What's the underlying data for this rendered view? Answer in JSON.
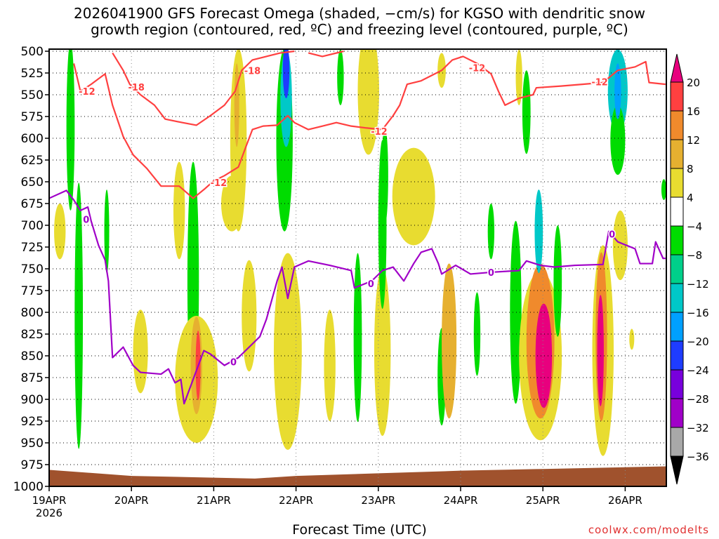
{
  "chart_data": {
    "type": "heatmap",
    "title_line1": "2026041900 GFS Forecast Omega (shaded, −cm/s) for KGSO with dendritic snow",
    "title_line2": "growth region (contoured, red, ºC) and freezing level (contoured, purple, ºC)",
    "xlabel": "Forecast Time (UTC)",
    "credit": "coolwx.com/modelts",
    "x_unit": "days since 19APR 00Z",
    "xlim": [
      0,
      7.5
    ],
    "ylim": [
      500,
      1000
    ],
    "y_ticks": [
      "500",
      "525",
      "550",
      "575",
      "600",
      "625",
      "650",
      "675",
      "700",
      "725",
      "750",
      "775",
      "800",
      "825",
      "850",
      "875",
      "900",
      "925",
      "950",
      "975",
      "1000"
    ],
    "x_ticks": [
      {
        "t": 0,
        "label": "19APR",
        "sub": "2026"
      },
      {
        "t": 1,
        "label": "20APR"
      },
      {
        "t": 2,
        "label": "21APR"
      },
      {
        "t": 3,
        "label": "22APR"
      },
      {
        "t": 4,
        "label": "23APR"
      },
      {
        "t": 5,
        "label": "24APR"
      },
      {
        "t": 6,
        "label": "25APR"
      },
      {
        "t": 7,
        "label": "26APR"
      }
    ],
    "grid": "dotted",
    "colorbar": {
      "labels": [
        "20",
        "16",
        "12",
        "8",
        "4",
        "−4",
        "−8",
        "−12",
        "−16",
        "−20",
        "−24",
        "−28",
        "−32",
        "−36"
      ],
      "over_color": "#e8007e",
      "under_color": "#000000",
      "colors": [
        "#ff4040",
        "#f08a2c",
        "#e6b030",
        "#e8dc30",
        "#ffffff",
        "#00dc00",
        "#00d08a",
        "#00c8c8",
        "#00a0ff",
        "#1e3cff",
        "#7800dc",
        "#a000c8",
        "#a8a8a8"
      ]
    },
    "omega_regions": [
      {
        "t": 0.26,
        "p": 586,
        "dt": 0.05,
        "dp": 97,
        "v": -6
      },
      {
        "t": 0.36,
        "p": 804,
        "dt": 0.05,
        "dp": 153,
        "v": -6
      },
      {
        "t": 0.13,
        "p": 707,
        "dt": 0.07,
        "dp": 32,
        "v": 6
      },
      {
        "t": 1.11,
        "p": 845,
        "dt": 0.09,
        "dp": 48,
        "v": 6
      },
      {
        "t": 0.7,
        "p": 707,
        "dt": 0.03,
        "dp": 48,
        "v": -6
      },
      {
        "t": 1.75,
        "p": 764,
        "dt": 0.07,
        "dp": 137,
        "v": -6
      },
      {
        "t": 1.79,
        "p": 877,
        "dt": 0.26,
        "dp": 73,
        "v": 6
      },
      {
        "t": 1.79,
        "p": 861,
        "dt": 0.07,
        "dp": 56,
        "v": 10
      },
      {
        "t": 1.81,
        "p": 861,
        "dt": 0.03,
        "dp": 40,
        "v": 18
      },
      {
        "t": 1.58,
        "p": 683,
        "dt": 0.07,
        "dp": 56,
        "v": 6
      },
      {
        "t": 2.3,
        "p": 602,
        "dt": 0.1,
        "dp": 105,
        "v": 6
      },
      {
        "t": 2.28,
        "p": 562,
        "dt": 0.03,
        "dp": 48,
        "v": 10
      },
      {
        "t": 2.22,
        "p": 675,
        "dt": 0.13,
        "dp": 32,
        "v": 6
      },
      {
        "t": 2.86,
        "p": 602,
        "dt": 0.1,
        "dp": 105,
        "v": -6
      },
      {
        "t": 2.88,
        "p": 554,
        "dt": 0.07,
        "dp": 56,
        "v": -14
      },
      {
        "t": 2.88,
        "p": 522,
        "dt": 0.04,
        "dp": 32,
        "v": -22
      },
      {
        "t": 2.9,
        "p": 845,
        "dt": 0.17,
        "dp": 113,
        "v": 6
      },
      {
        "t": 2.43,
        "p": 804,
        "dt": 0.09,
        "dp": 64,
        "v": 6
      },
      {
        "t": 3.88,
        "p": 546,
        "dt": 0.13,
        "dp": 73,
        "v": 6
      },
      {
        "t": 3.41,
        "p": 861,
        "dt": 0.07,
        "dp": 64,
        "v": 6
      },
      {
        "t": 3.75,
        "p": 829,
        "dt": 0.05,
        "dp": 97,
        "v": -6
      },
      {
        "t": 4.05,
        "p": 845,
        "dt": 0.1,
        "dp": 97,
        "v": 6
      },
      {
        "t": 4.05,
        "p": 699,
        "dt": 0.05,
        "dp": 97,
        "v": -6
      },
      {
        "t": 4.43,
        "p": 667,
        "dt": 0.26,
        "dp": 56,
        "v": 6
      },
      {
        "t": 4.77,
        "p": 874,
        "dt": 0.05,
        "dp": 56,
        "v": -6
      },
      {
        "t": 4.86,
        "p": 833,
        "dt": 0.09,
        "dp": 89,
        "v": 10
      },
      {
        "t": 5.2,
        "p": 825,
        "dt": 0.04,
        "dp": 48,
        "v": -6
      },
      {
        "t": 5.67,
        "p": 800,
        "dt": 0.07,
        "dp": 105,
        "v": -6
      },
      {
        "t": 5.97,
        "p": 850,
        "dt": 0.26,
        "dp": 97,
        "v": 6
      },
      {
        "t": 5.97,
        "p": 833,
        "dt": 0.17,
        "dp": 89,
        "v": 14
      },
      {
        "t": 6.01,
        "p": 850,
        "dt": 0.1,
        "dp": 60,
        "v": 24
      },
      {
        "t": 5.95,
        "p": 707,
        "dt": 0.05,
        "dp": 48,
        "v": -14
      },
      {
        "t": 6.18,
        "p": 764,
        "dt": 0.05,
        "dp": 64,
        "v": -6
      },
      {
        "t": 5.8,
        "p": 570,
        "dt": 0.05,
        "dp": 48,
        "v": -6
      },
      {
        "t": 6.73,
        "p": 844,
        "dt": 0.13,
        "dp": 121,
        "v": 6
      },
      {
        "t": 6.71,
        "p": 828,
        "dt": 0.07,
        "dp": 97,
        "v": 14
      },
      {
        "t": 6.7,
        "p": 844,
        "dt": 0.04,
        "dp": 64,
        "v": 24
      },
      {
        "t": 6.91,
        "p": 546,
        "dt": 0.12,
        "dp": 48,
        "v": -14
      },
      {
        "t": 6.91,
        "p": 602,
        "dt": 0.09,
        "dp": 40,
        "v": -6
      },
      {
        "t": 6.91,
        "p": 546,
        "dt": 0.04,
        "dp": 32,
        "v": -18
      },
      {
        "t": 6.94,
        "p": 723,
        "dt": 0.09,
        "dp": 40,
        "v": 6
      },
      {
        "t": 7.47,
        "p": 659,
        "dt": 0.03,
        "dp": 12,
        "v": -6
      },
      {
        "t": 7.08,
        "p": 831,
        "dt": 0.03,
        "dp": 12,
        "v": 6
      },
      {
        "t": 5.37,
        "p": 707,
        "dt": 0.04,
        "dp": 32,
        "v": -6
      },
      {
        "t": 5.71,
        "p": 530,
        "dt": 0.04,
        "dp": 32,
        "v": 6
      },
      {
        "t": 4.77,
        "p": 522,
        "dt": 0.05,
        "dp": 20,
        "v": 6
      },
      {
        "t": 3.54,
        "p": 530,
        "dt": 0.04,
        "dp": 32,
        "v": -6
      },
      {
        "t": 4.08,
        "p": 643,
        "dt": 0.04,
        "dp": 56,
        "v": -6
      }
    ],
    "surface_pressure": [
      [
        0,
        981
      ],
      [
        1,
        988
      ],
      [
        2,
        990
      ],
      [
        2.5,
        991
      ],
      [
        3,
        988
      ],
      [
        4,
        985
      ],
      [
        5,
        982
      ],
      [
        6,
        980
      ],
      [
        7.5,
        977
      ]
    ],
    "dgz_contours": [
      {
        "level": -12,
        "color": "#ff4040",
        "points": [
          [
            0.3,
            514
          ],
          [
            0.38,
            546
          ],
          [
            0.51,
            538
          ],
          [
            0.68,
            526
          ],
          [
            0.77,
            562
          ],
          [
            0.9,
            598
          ],
          [
            1.02,
            619
          ],
          [
            1.19,
            635
          ],
          [
            1.36,
            655
          ],
          [
            1.58,
            655
          ],
          [
            1.75,
            669
          ],
          [
            1.88,
            659
          ],
          [
            2.0,
            649
          ],
          [
            2.13,
            643
          ],
          [
            2.3,
            633
          ],
          [
            2.39,
            610
          ],
          [
            2.47,
            590
          ],
          [
            2.6,
            586
          ],
          [
            2.77,
            585
          ],
          [
            2.9,
            574
          ],
          [
            2.98,
            582
          ],
          [
            3.15,
            590
          ],
          [
            3.32,
            586
          ],
          [
            3.49,
            582
          ],
          [
            3.67,
            586
          ],
          [
            3.84,
            588
          ],
          [
            4.05,
            590
          ],
          [
            4.18,
            574
          ],
          [
            4.26,
            562
          ],
          [
            4.35,
            538
          ],
          [
            4.52,
            534
          ],
          [
            4.77,
            522
          ],
          [
            4.9,
            510
          ],
          [
            5.03,
            506
          ],
          [
            5.2,
            514
          ],
          [
            5.37,
            526
          ],
          [
            5.46,
            546
          ],
          [
            5.54,
            562
          ],
          [
            5.71,
            554
          ],
          [
            5.88,
            550
          ],
          [
            5.92,
            542
          ],
          [
            6.22,
            540
          ],
          [
            6.48,
            538
          ],
          [
            6.73,
            536
          ],
          [
            6.91,
            522
          ],
          [
            7.12,
            518
          ],
          [
            7.25,
            512
          ],
          [
            7.29,
            536
          ],
          [
            7.49,
            538
          ]
        ]
      },
      {
        "level": -18,
        "color": "#ff4040",
        "points": [
          [
            0.77,
            502
          ],
          [
            0.9,
            522
          ],
          [
            0.98,
            538
          ],
          [
            1.11,
            550
          ],
          [
            1.28,
            562
          ],
          [
            1.41,
            578
          ],
          [
            1.62,
            582
          ],
          [
            1.79,
            585
          ],
          [
            1.96,
            574
          ],
          [
            2.13,
            562
          ],
          [
            2.26,
            546
          ],
          [
            2.34,
            522
          ],
          [
            2.47,
            510
          ],
          [
            2.64,
            506
          ],
          [
            2.81,
            502
          ],
          [
            2.98,
            500
          ]
        ]
      },
      {
        "level": -18,
        "color": "#ff4040",
        "points": [
          [
            3.15,
            502
          ],
          [
            3.32,
            506
          ],
          [
            3.58,
            500
          ]
        ]
      }
    ],
    "freezing_level": {
      "level": 0,
      "color": "#a000c8",
      "points": [
        [
          0,
          669
        ],
        [
          0.21,
          660
        ],
        [
          0.3,
          671
        ],
        [
          0.38,
          683
        ],
        [
          0.47,
          679
        ],
        [
          0.51,
          695
        ],
        [
          0.6,
          723
        ],
        [
          0.68,
          740
        ],
        [
          0.72,
          764
        ],
        [
          0.77,
          852
        ],
        [
          0.9,
          840
        ],
        [
          1.02,
          861
        ],
        [
          1.11,
          869
        ],
        [
          1.36,
          871
        ],
        [
          1.45,
          865
        ],
        [
          1.53,
          881
        ],
        [
          1.6,
          877
        ],
        [
          1.64,
          905
        ],
        [
          1.75,
          877
        ],
        [
          1.88,
          844
        ],
        [
          1.96,
          848
        ],
        [
          2.13,
          861
        ],
        [
          2.3,
          852
        ],
        [
          2.43,
          840
        ],
        [
          2.56,
          828
        ],
        [
          2.64,
          808
        ],
        [
          2.77,
          764
        ],
        [
          2.83,
          748
        ],
        [
          2.9,
          784
        ],
        [
          2.98,
          748
        ],
        [
          3.15,
          741
        ],
        [
          3.41,
          746
        ],
        [
          3.67,
          752
        ],
        [
          3.71,
          772
        ],
        [
          3.92,
          764
        ],
        [
          4.05,
          752
        ],
        [
          4.18,
          748
        ],
        [
          4.31,
          764
        ],
        [
          4.43,
          744
        ],
        [
          4.52,
          731
        ],
        [
          4.65,
          727
        ],
        [
          4.73,
          744
        ],
        [
          4.77,
          756
        ],
        [
          4.94,
          746
        ],
        [
          5.12,
          756
        ],
        [
          5.37,
          754
        ],
        [
          5.71,
          752
        ],
        [
          5.8,
          741
        ],
        [
          5.97,
          746
        ],
        [
          6.14,
          748
        ],
        [
          6.39,
          746
        ],
        [
          6.73,
          745
        ],
        [
          6.8,
          707
        ],
        [
          6.91,
          719
        ],
        [
          7.12,
          727
        ],
        [
          7.18,
          744
        ],
        [
          7.33,
          744
        ],
        [
          7.37,
          719
        ],
        [
          7.46,
          738
        ],
        [
          7.49,
          738
        ]
      ]
    },
    "contour_labels": [
      {
        "t": 0.46,
        "p": 546,
        "text": "-12",
        "color": "#ff4040"
      },
      {
        "t": 2.06,
        "p": 651,
        "text": "-12",
        "color": "#ff4040"
      },
      {
        "t": 4.01,
        "p": 592,
        "text": "-12",
        "color": "#ff4040"
      },
      {
        "t": 5.2,
        "p": 519,
        "text": "-12",
        "color": "#ff4040"
      },
      {
        "t": 6.69,
        "p": 535,
        "text": "-12",
        "color": "#ff4040"
      },
      {
        "t": 1.06,
        "p": 541,
        "text": "-18",
        "color": "#ff4040"
      },
      {
        "t": 2.47,
        "p": 522,
        "text": "-18",
        "color": "#ff4040"
      },
      {
        "t": 0.45,
        "p": 693,
        "text": "0",
        "color": "#a000c8"
      },
      {
        "t": 2.24,
        "p": 857,
        "text": "0",
        "color": "#a000c8"
      },
      {
        "t": 3.91,
        "p": 767,
        "text": "0",
        "color": "#a000c8"
      },
      {
        "t": 5.37,
        "p": 754,
        "text": "0",
        "color": "#a000c8"
      },
      {
        "t": 6.84,
        "p": 710,
        "text": "0",
        "color": "#a000c8"
      }
    ]
  }
}
